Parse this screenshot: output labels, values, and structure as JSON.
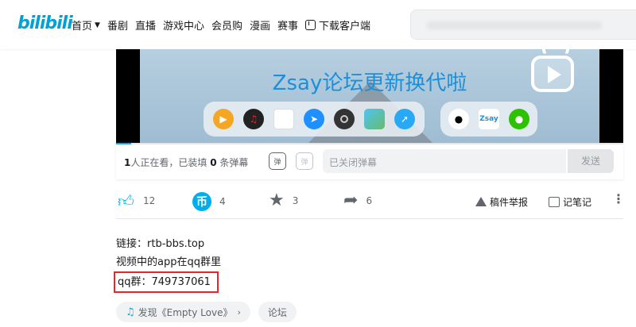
{
  "header": {
    "logo": "bilibili",
    "nav": [
      {
        "label": "首页",
        "dropdown": true
      },
      {
        "label": "番剧"
      },
      {
        "label": "直播"
      },
      {
        "label": "游戏中心"
      },
      {
        "label": "会员购"
      },
      {
        "label": "漫画"
      },
      {
        "label": "赛事"
      },
      {
        "label": "下载客户端",
        "icon": "download-icon"
      }
    ]
  },
  "video": {
    "overlay_title": "Zsay论坛更新换代啦",
    "dock_apps": [
      "player-app-icon",
      "music-app-icon",
      "notes-app-icon",
      "safari-icon",
      "camera-app-icon",
      "photos-app-icon",
      "compass-app-icon"
    ],
    "dock2_apps": [
      "qq-icon",
      "zsay-icon",
      "wechat-icon"
    ],
    "zsay_label": "Zsay"
  },
  "danmaku": {
    "viewers_count": "1",
    "viewers_text": "人正在看，已装填",
    "dm_count": "0",
    "dm_suffix": "条弹幕",
    "toggle_label": "弹",
    "input_placeholder": "已关闭弹幕",
    "send_label": "发送"
  },
  "toolbar": {
    "likes": "12",
    "coins": "4",
    "favorites": "3",
    "shares": "6",
    "report_label": "稿件举报",
    "notes_label": "记笔记",
    "coin_glyph": "币"
  },
  "description": {
    "line1": "链接：rtb-bbs.top",
    "line2": "视频中的app在qq群里",
    "line3": "qq群：749737061"
  },
  "tags": [
    {
      "label": "发现《Empty Love》",
      "icon": "music-note-icon",
      "has_arrow": true
    },
    {
      "label": "论坛"
    }
  ],
  "colors": {
    "accent": "#00aeec",
    "brand": "#00a1d6",
    "highlight_box": "#e0282e"
  }
}
